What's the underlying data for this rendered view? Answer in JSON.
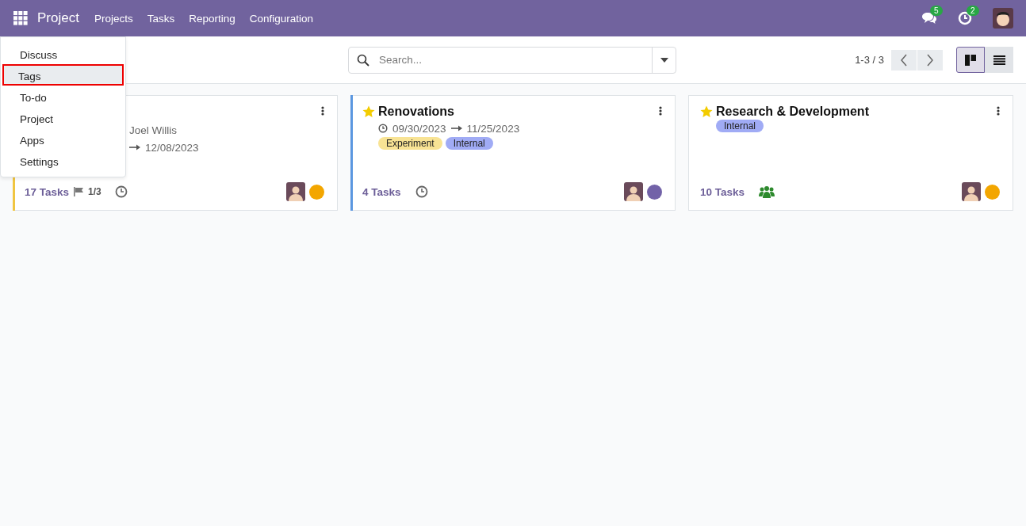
{
  "navbar": {
    "app": "Project",
    "menus": [
      "Projects",
      "Tasks",
      "Reporting",
      "Configuration"
    ],
    "messages_badge": "5",
    "activities_badge": "2"
  },
  "dropdown": [
    {
      "label": "Discuss",
      "selected": false
    },
    {
      "label": "Tags",
      "selected": true
    },
    {
      "label": "To-do",
      "selected": false
    },
    {
      "label": "Project",
      "selected": false
    },
    {
      "label": "Apps",
      "selected": false
    },
    {
      "label": "Settings",
      "selected": false
    }
  ],
  "search": {
    "placeholder": "Search..."
  },
  "pager": "1-3 / 3",
  "views": [
    {
      "kind": "kanban",
      "selected": true
    },
    {
      "kind": "list",
      "selected": false
    }
  ],
  "cards": [
    {
      "customer": "Joel Willis",
      "dates": {
        "end": "12/08/2023"
      },
      "color": "#f0c541",
      "tasks": "17 Tasks",
      "milestone": "1/3",
      "activity": {
        "kind": "clock"
      },
      "status": {
        "color": "#f3a600"
      }
    },
    {
      "favorite": true,
      "title": "Renovations",
      "dates": {
        "start": "09/30/2023",
        "end": "11/25/2023"
      },
      "tags": [
        {
          "label": "Experiment",
          "color": "#f8e394"
        },
        {
          "label": "Internal",
          "color": "#a0abf5"
        }
      ],
      "color": "#5b97e0",
      "tasks": "4 Tasks",
      "activity": {
        "kind": "clock"
      },
      "status": {
        "color": "#7262a8"
      }
    },
    {
      "favorite": true,
      "title": "Research & Development",
      "tags": [
        {
          "label": "Internal",
          "color": "#a0abf5"
        }
      ],
      "tasks": "10 Tasks",
      "activity": {
        "kind": "group"
      },
      "status": {
        "color": "#f3a600"
      }
    }
  ]
}
